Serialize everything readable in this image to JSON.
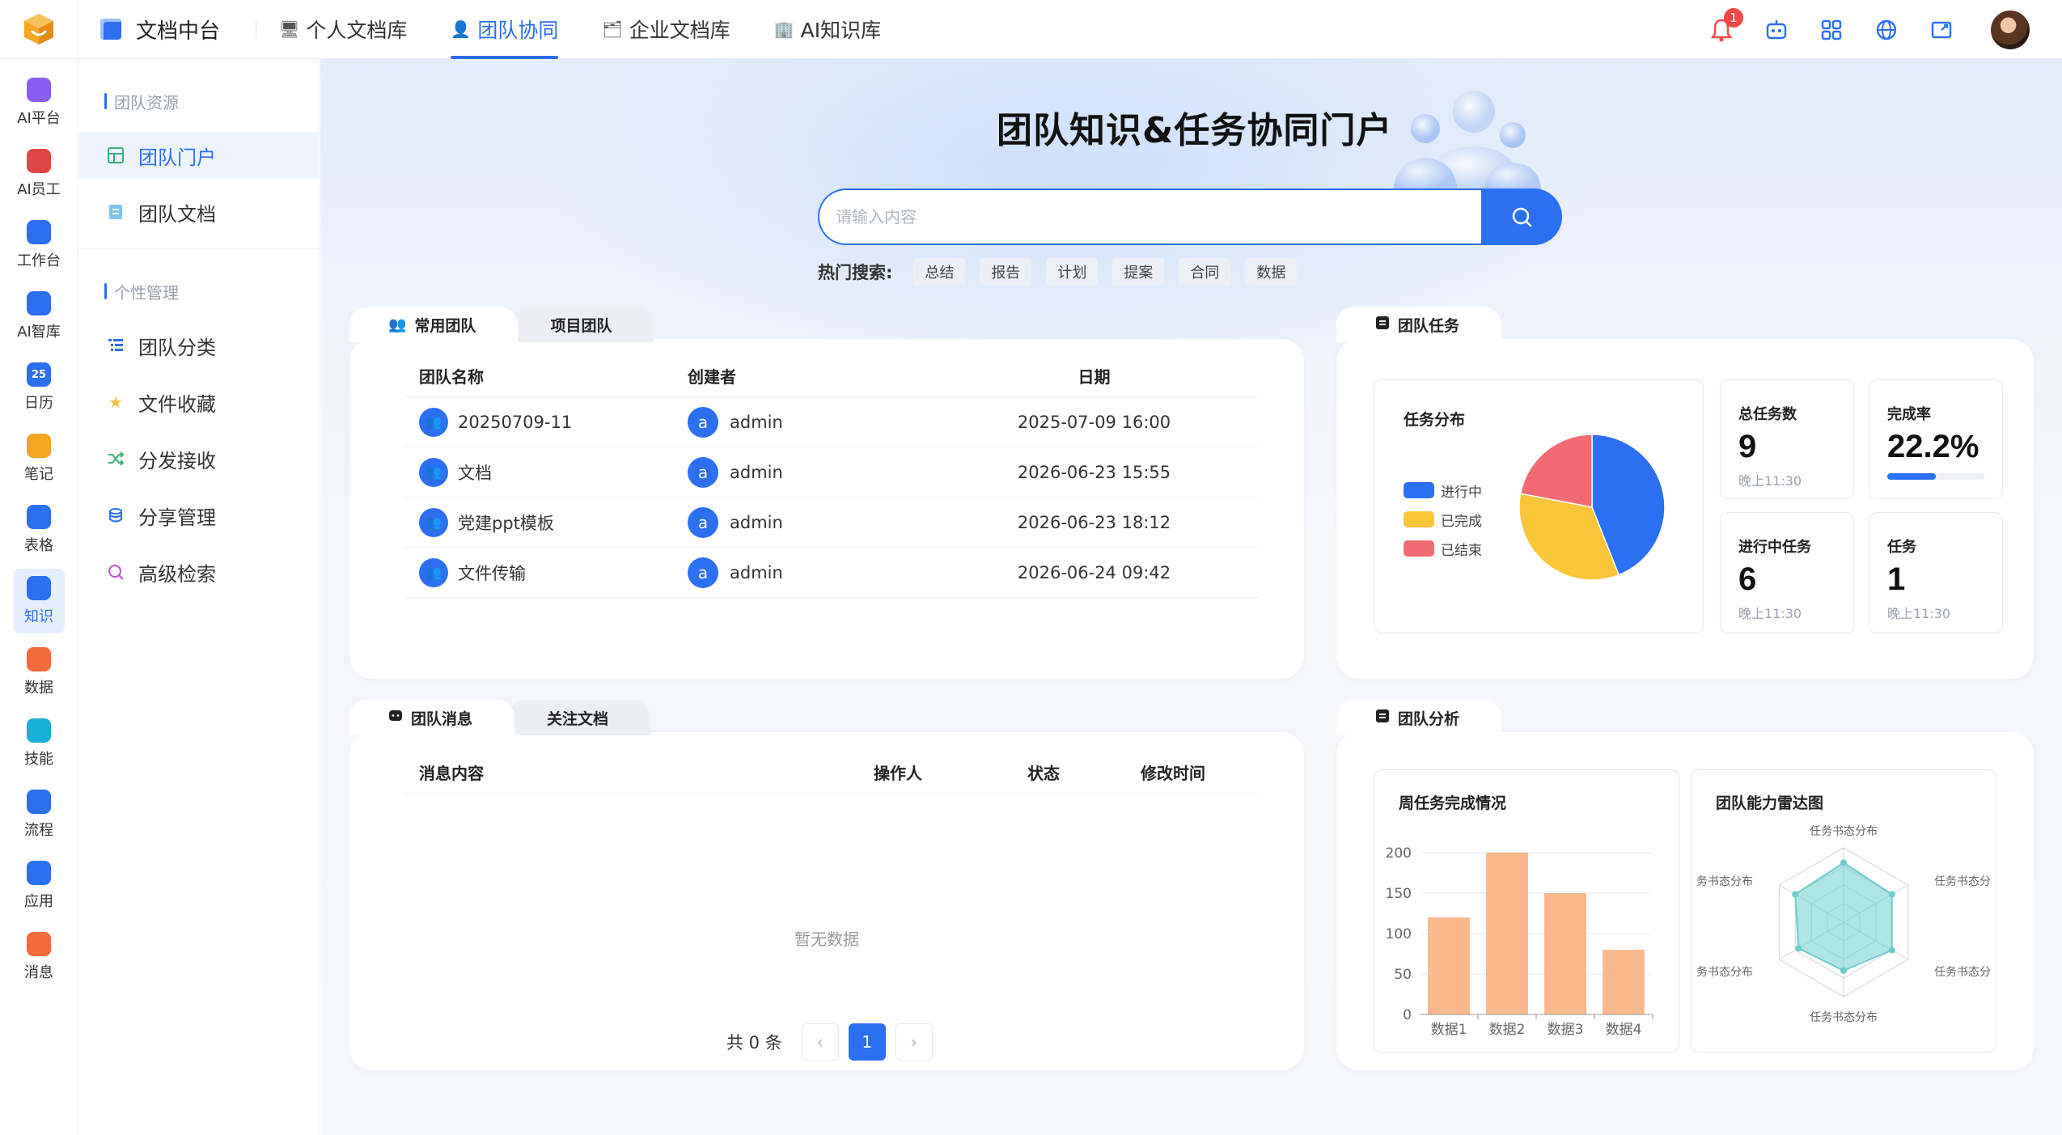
{
  "topbar": {
    "brand": "文档中台",
    "nav": [
      {
        "label": "个人文档库",
        "icon": "monitor-icon"
      },
      {
        "label": "团队协同",
        "icon": "users-icon",
        "active": true
      },
      {
        "label": "企业文档库",
        "icon": "folder-icon"
      },
      {
        "label": "AI知识库",
        "icon": "building-icon"
      }
    ],
    "notification_count": "1"
  },
  "rail": [
    {
      "label": "AI平台",
      "icon": "ai-platform-icon",
      "color": "#8a5cf6"
    },
    {
      "label": "AI员工",
      "icon": "ai-employee-icon",
      "color": "#e04646"
    },
    {
      "label": "工作台",
      "icon": "home-icon",
      "color": "#2b6ff2"
    },
    {
      "label": "AI智库",
      "icon": "target-icon",
      "color": "#2b6ff2"
    },
    {
      "label": "日历",
      "icon": "calendar-icon",
      "color": "#2b6ff2",
      "glyph": "25"
    },
    {
      "label": "笔记",
      "icon": "note-icon",
      "color": "#f5a623"
    },
    {
      "label": "表格",
      "icon": "table-icon",
      "color": "#2b6ff2"
    },
    {
      "label": "知识",
      "icon": "knowledge-icon",
      "color": "#2b6ff2",
      "active": true
    },
    {
      "label": "数据",
      "icon": "pie-icon",
      "color": "#f26b3a"
    },
    {
      "label": "技能",
      "icon": "skill-icon",
      "color": "#17b1d6"
    },
    {
      "label": "流程",
      "icon": "gear-icon",
      "color": "#2b6ff2"
    },
    {
      "label": "应用",
      "icon": "apps-icon",
      "color": "#2b6ff2"
    },
    {
      "label": "消息",
      "icon": "speaker-icon",
      "color": "#f26b3a"
    }
  ],
  "sidebar": {
    "group1": "团队资源",
    "group1_items": [
      {
        "label": "团队门户",
        "icon": "portal-icon",
        "active": true
      },
      {
        "label": "团队文档",
        "icon": "doc-icon"
      }
    ],
    "group2": "个性管理",
    "group2_items": [
      {
        "label": "团队分类",
        "icon": "list-icon"
      },
      {
        "label": "文件收藏",
        "icon": "star-icon"
      },
      {
        "label": "分发接收",
        "icon": "shuffle-icon"
      },
      {
        "label": "分享管理",
        "icon": "share-icon"
      },
      {
        "label": "高级检索",
        "icon": "search-icon"
      }
    ]
  },
  "hero": {
    "title": "团队知识&任务协同门户",
    "search_placeholder": "请输入内容",
    "hot_label": "热门搜索:",
    "hot_tags": [
      "总结",
      "报告",
      "计划",
      "提案",
      "合同",
      "数据"
    ]
  },
  "teams": {
    "tabs": [
      "常用团队",
      "项目团队"
    ],
    "headers": {
      "name": "团队名称",
      "creator": "创建者",
      "date": "日期"
    },
    "rows": [
      {
        "name": "20250709-11",
        "creator_initial": "a",
        "creator": "admin",
        "date": "2025-07-09 16:00"
      },
      {
        "name": "文档",
        "creator_initial": "a",
        "creator": "admin",
        "date": "2026-06-23 15:55"
      },
      {
        "name": "党建ppt模板",
        "creator_initial": "a",
        "creator": "admin",
        "date": "2026-06-23 18:12"
      },
      {
        "name": "文件传输",
        "creator_initial": "a",
        "creator": "admin",
        "date": "2026-06-24 09:42"
      }
    ]
  },
  "tasks": {
    "tab": "团队任务",
    "dist_title": "任务分布",
    "legend": [
      {
        "label": "进行中",
        "color": "#2b6ff2"
      },
      {
        "label": "已完成",
        "color": "#fbc53a"
      },
      {
        "label": "已结束",
        "color": "#f26b72"
      }
    ],
    "pie": [
      {
        "label": "进行中",
        "value": 44,
        "color": "#2b6ff2"
      },
      {
        "label": "已完成",
        "value": 34,
        "color": "#fbc53a"
      },
      {
        "label": "已结束",
        "value": 22,
        "color": "#f26b72"
      }
    ],
    "stats": {
      "total_label": "总任务数",
      "total_value": "9",
      "total_sub": "晚上11:30",
      "rate_label": "完成率",
      "rate_value": "22.2%",
      "rate_fraction": 0.5,
      "doing_label": "进行中任务",
      "doing_value": "6",
      "doing_sub": "晚上11:30",
      "task_label": "任务",
      "task_value": "1",
      "task_sub": "晚上11:30"
    }
  },
  "messages": {
    "tabs": [
      "团队消息",
      "关注文档"
    ],
    "headers": {
      "content": "消息内容",
      "operator": "操作人",
      "status": "状态",
      "time": "修改时间"
    },
    "empty": "暂无数据",
    "total": "共 0 条",
    "page": "1"
  },
  "analysis": {
    "tab": "团队分析",
    "weekly_title": "周任务完成情况",
    "radar_title": "团队能力雷达图",
    "radar_labels": {
      "top": "任务书态分布",
      "upper_right": "任务书态分",
      "lower_right": "任务书态分",
      "bottom": "任务书态分布",
      "lower_left": "务书态分布",
      "upper_left": "务书态分布"
    },
    "radar_values": [
      0.8,
      0.75,
      0.75,
      0.65,
      0.7,
      0.75
    ]
  },
  "chart_data": {
    "type": "bar",
    "title": "周任务完成情况",
    "categories": [
      "数据1",
      "数据2",
      "数据3",
      "数据4"
    ],
    "values": [
      120,
      200,
      150,
      80
    ],
    "ylim": [
      0,
      200
    ],
    "yticks": [
      "0",
      "50",
      "100",
      "150",
      "200"
    ],
    "bar_color": "#fbb88a"
  }
}
